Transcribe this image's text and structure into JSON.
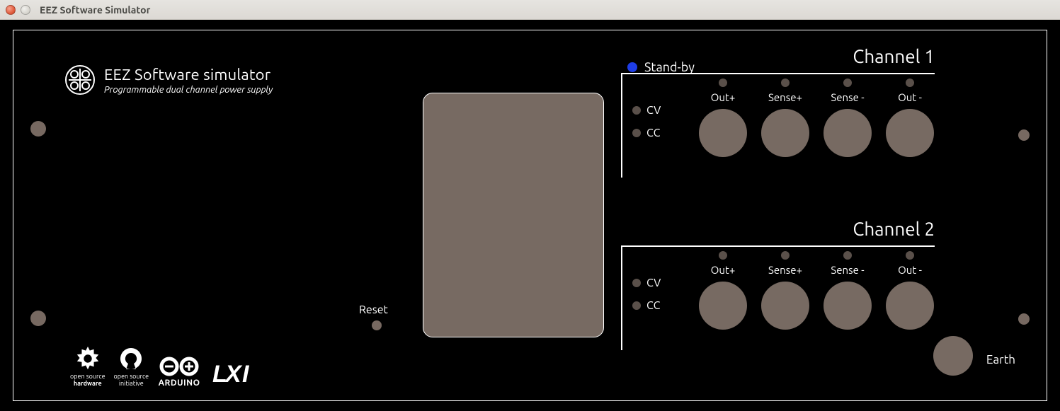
{
  "window": {
    "title": "EEZ Software Simulator"
  },
  "logo": {
    "title": "EEZ Software simulator",
    "subtitle": "Programmable dual channel power supply"
  },
  "standby": {
    "label": "Stand-by",
    "color": "#1e3de6"
  },
  "reset": {
    "label": "Reset"
  },
  "channels": [
    {
      "title": "Channel 1",
      "cv_label": "CV",
      "cc_label": "CC",
      "terminals": [
        {
          "label": "Out+"
        },
        {
          "label": "Sense+"
        },
        {
          "label": "Sense -"
        },
        {
          "label": "Out -"
        }
      ]
    },
    {
      "title": "Channel 2",
      "cv_label": "CV",
      "cc_label": "CC",
      "terminals": [
        {
          "label": "Out+"
        },
        {
          "label": "Sense+"
        },
        {
          "label": "Sense -"
        },
        {
          "label": "Out -"
        }
      ]
    }
  ],
  "earth": {
    "label": "Earth"
  },
  "footer": {
    "oshw": {
      "line1": "open source",
      "line2": "hardware"
    },
    "osi": {
      "line1": "open source",
      "line2": "initiative"
    },
    "arduino": {
      "label": "ARDUINO"
    }
  }
}
